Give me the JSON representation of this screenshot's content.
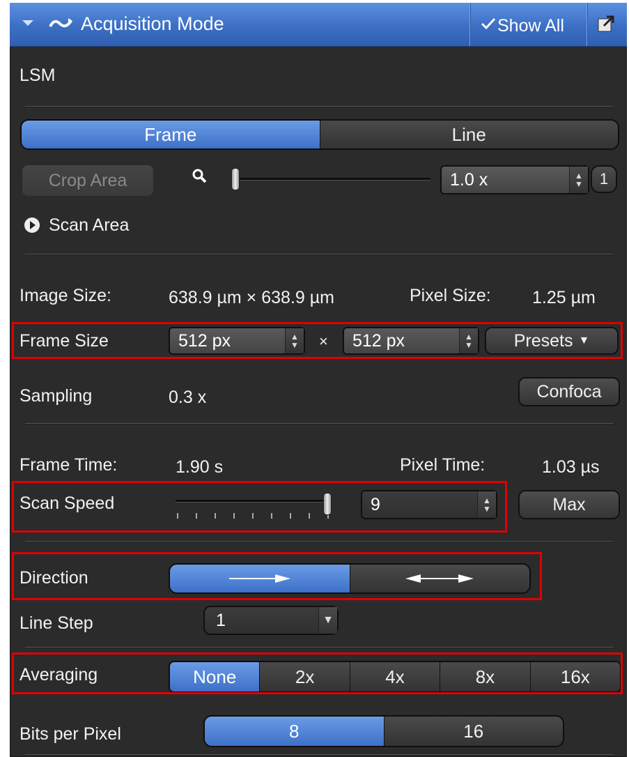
{
  "header": {
    "title": "Acquisition Mode",
    "show_all": "Show All"
  },
  "section_label": "LSM",
  "scan_mode": {
    "options": [
      "Frame",
      "Line"
    ],
    "selected": "Frame"
  },
  "crop": {
    "button": "Crop Area",
    "zoom_value": "1.0 x",
    "reset": "1",
    "zoom_level": 0.0
  },
  "scan_area": {
    "label": "Scan Area"
  },
  "image_size": {
    "label": "Image Size:",
    "value": "638.9 µm × 638.9 µm",
    "pixel_label": "Pixel Size:",
    "pixel_value": "1.25 µm"
  },
  "frame_size": {
    "label": "Frame Size",
    "width": "512 px",
    "times": "×",
    "height": "512 px",
    "presets": "Presets"
  },
  "sampling": {
    "label": "Sampling",
    "value": "0.3 x",
    "button": "Confoca"
  },
  "times": {
    "frame_label": "Frame Time:",
    "frame_value": "1.90 s",
    "pixel_label": "Pixel Time:",
    "pixel_value": "1.03 µs"
  },
  "scan_speed": {
    "label": "Scan Speed",
    "value": "9",
    "max": "Max",
    "level": 1.0
  },
  "direction": {
    "label": "Direction",
    "options": [
      "unidirectional",
      "bidirectional"
    ],
    "selected": "unidirectional"
  },
  "line_step": {
    "label": "Line Step",
    "value": "1"
  },
  "averaging": {
    "label": "Averaging",
    "options": [
      "None",
      "2x",
      "4x",
      "8x",
      "16x"
    ],
    "selected": "None"
  },
  "bits": {
    "label": "Bits per Pixel",
    "options": [
      "8",
      "16"
    ],
    "selected": "8"
  },
  "colors": {
    "accent": "#3d70c8",
    "highlight_box": "#e00000",
    "panel_bg": "#2b2b2b"
  }
}
